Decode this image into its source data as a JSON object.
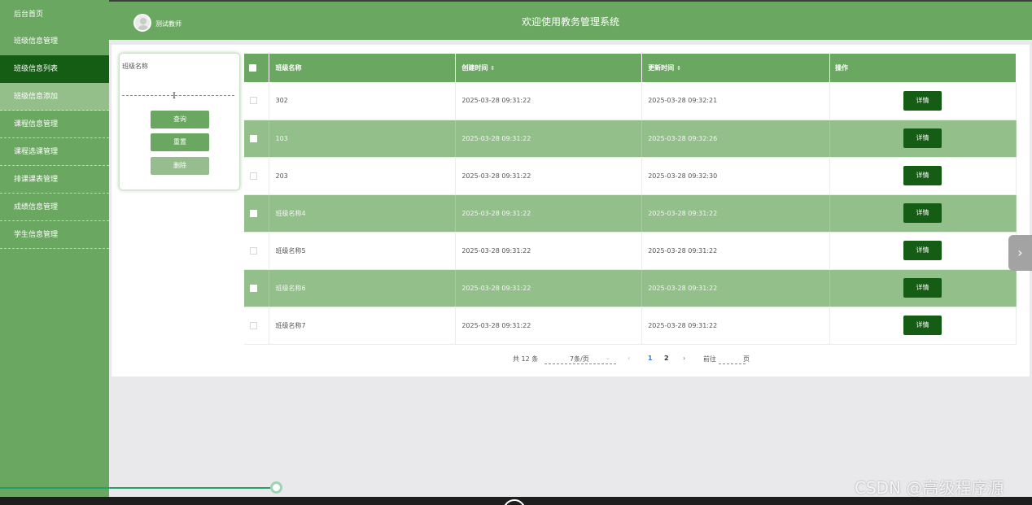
{
  "sidebar": {
    "items": [
      {
        "label": "后台首页"
      },
      {
        "label": "班级信息管理"
      },
      {
        "label": "班级信息列表"
      },
      {
        "label": "班级信息添加"
      },
      {
        "label": "课程信息管理"
      },
      {
        "label": "课程选课管理"
      },
      {
        "label": "排课课表管理"
      },
      {
        "label": "成绩信息管理"
      },
      {
        "label": "学生信息管理"
      }
    ]
  },
  "header": {
    "user_name": "测试教师",
    "title": "欢迎使用教务管理系统"
  },
  "search": {
    "label": "班级名称",
    "value": "",
    "query_button": "查询",
    "reset_button": "重置",
    "delete_button": "删除"
  },
  "table": {
    "headers": {
      "name": "班级名称",
      "created": "创建时间",
      "updated": "更新时间",
      "ops": "操作"
    },
    "sort_icon": "⇕",
    "detail_label": "详情",
    "rows": [
      {
        "name": "302",
        "created": "2025-03-28 09:31:22",
        "updated": "2025-03-28 09:32:21"
      },
      {
        "name": "103",
        "created": "2025-03-28 09:31:22",
        "updated": "2025-03-28 09:32:26"
      },
      {
        "name": "203",
        "created": "2025-03-28 09:31:22",
        "updated": "2025-03-28 09:32:30"
      },
      {
        "name": "班级名称4",
        "created": "2025-03-28 09:31:22",
        "updated": "2025-03-28 09:31:22"
      },
      {
        "name": "班级名称5",
        "created": "2025-03-28 09:31:22",
        "updated": "2025-03-28 09:31:22"
      },
      {
        "name": "班级名称6",
        "created": "2025-03-28 09:31:22",
        "updated": "2025-03-28 09:31:22"
      },
      {
        "name": "班级名称7",
        "created": "2025-03-28 09:31:22",
        "updated": "2025-03-28 09:31:22"
      }
    ]
  },
  "pagination": {
    "total": "共 12 条",
    "page_size": "7条/页",
    "pages": [
      "1",
      "2"
    ],
    "current_page": "1",
    "goto_label": "前往",
    "page_unit": "页"
  },
  "overlay": {
    "watermark": "CSDN @高级程序源",
    "expand_glyph": "›"
  },
  "colors": {
    "primary": "#6aa760",
    "dark": "#155d14",
    "row_alt": "#93bf8a",
    "page_active": "#2e7fe0"
  }
}
